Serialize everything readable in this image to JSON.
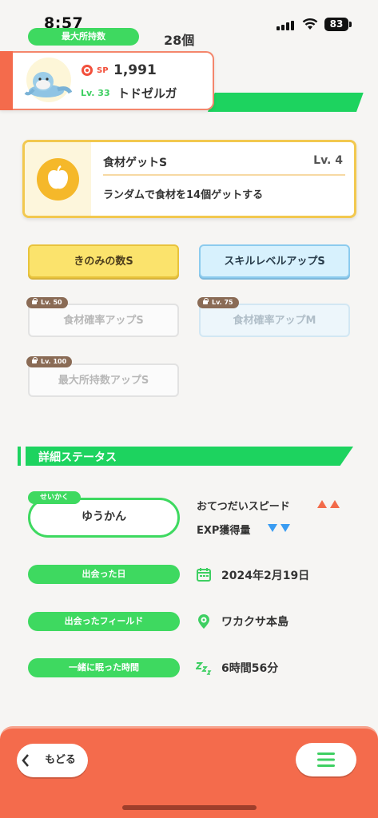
{
  "status_bar": {
    "time": "8:57",
    "battery": "83"
  },
  "holding": {
    "label": "最大所持数",
    "value": "28個"
  },
  "pokemon": {
    "sp_label": "SP",
    "sp_value": "1,991",
    "level": "Lv. 33",
    "name": "トドゼルガ"
  },
  "main_skill": {
    "name": "食材ゲットS",
    "level": "Lv. 4",
    "description": "ランダムで食材を14個ゲットする"
  },
  "sub_skills": [
    {
      "label": "きのみの数S",
      "style": "yellow",
      "locked": false
    },
    {
      "label": "スキルレベルアップS",
      "style": "blue",
      "locked": false
    },
    {
      "label": "食材確率アップS",
      "unlock_level": "Lv. 50",
      "style": "white",
      "locked": true
    },
    {
      "label": "食材確率アップM",
      "unlock_level": "Lv. 75",
      "style": "blue",
      "locked": true
    },
    {
      "label": "最大所持数アップS",
      "unlock_level": "Lv. 100",
      "style": "white",
      "locked": true
    }
  ],
  "details": {
    "title": "詳細ステータス",
    "nature_tag": "せいかく",
    "nature": "ゆうかん",
    "effects": [
      {
        "label": "おてつだいスピード",
        "direction": "up",
        "color": "#f26b4a"
      },
      {
        "label": "EXP獲得量",
        "direction": "down",
        "color": "#3a9cf2"
      }
    ],
    "met_date_label": "出会った日",
    "met_date": "2024年2月19日",
    "met_field_label": "出会ったフィールド",
    "met_field": "ワカクサ本島",
    "sleep_label": "一緒に眠った時間",
    "sleep_value": "6時間56分"
  },
  "nav": {
    "back_label": "もどる",
    "menu_icon": "hamburger-icon"
  },
  "colors": {
    "accent_green": "#3ed960",
    "accent_orange": "#f46b4c",
    "skill_gold": "#f2c84f"
  }
}
